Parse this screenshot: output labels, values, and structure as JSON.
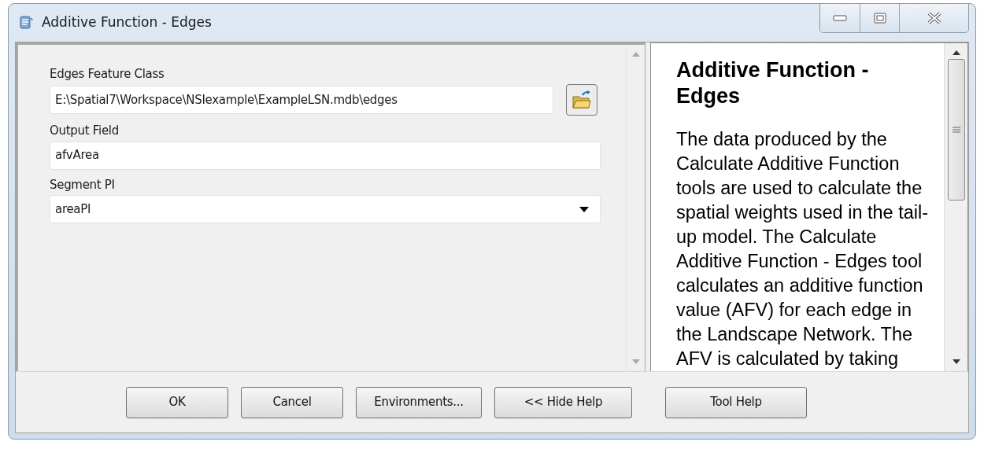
{
  "window": {
    "title": "Additive Function - Edges"
  },
  "parameters": [
    {
      "label": "Edges Feature Class",
      "kind": "path",
      "value": "E:\\Spatial7\\Workspace\\NSIexample\\ExampleLSN.mdb\\edges"
    },
    {
      "label": "Output Field",
      "kind": "text",
      "value": "afvArea"
    },
    {
      "label": "Segment PI",
      "kind": "dropdown",
      "value": "areaPI"
    }
  ],
  "help": {
    "title": "Additive Function - Edges",
    "lines": [
      "The data produced by the",
      "Calculate Additive Function",
      "tools are used to calculate the",
      "spatial weights used in the tail-",
      "up model. The Calculate",
      "Additive Function - Edges tool",
      "calculates an additive function",
      "value (AFV) for each edge in",
      "the Landscape Network. The",
      "AFV is calculated by taking"
    ]
  },
  "buttons": [
    "OK",
    "Cancel",
    "Environments...",
    "<< Hide Help",
    "Tool Help"
  ]
}
